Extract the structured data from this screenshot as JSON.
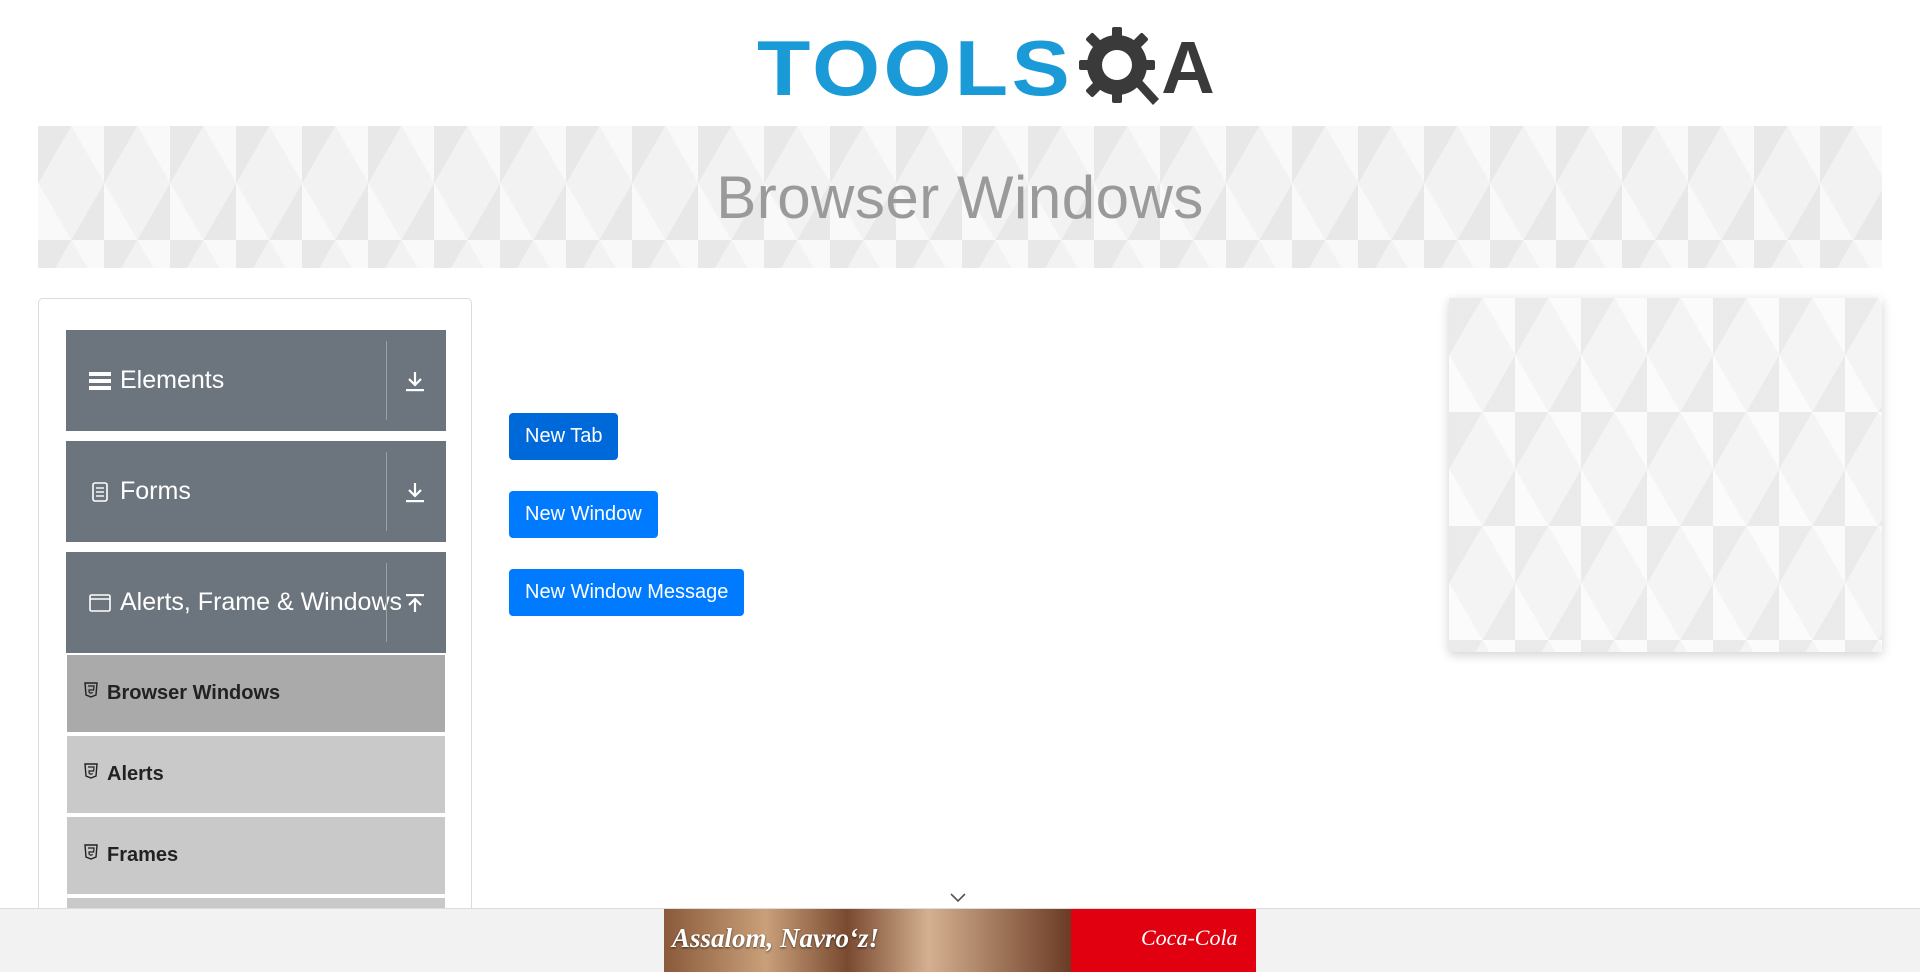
{
  "header": {
    "logo_text_left": "TOOLS",
    "logo_text_right": "A"
  },
  "banner": {
    "title": "Browser Windows"
  },
  "sidebar": {
    "groups": [
      {
        "label": "Elements",
        "icon": "hamburger-icon",
        "arrow": "download-arrow-icon"
      },
      {
        "label": "Forms",
        "icon": "document-icon",
        "arrow": "download-arrow-icon"
      },
      {
        "label": "Alerts, Frame & Windows",
        "icon": "window-icon",
        "arrow": "upload-arrow-icon"
      }
    ],
    "items": [
      {
        "label": "Browser Windows",
        "icon": "html5-icon",
        "active": true
      },
      {
        "label": "Alerts",
        "icon": "html5-icon",
        "active": false
      },
      {
        "label": "Frames",
        "icon": "html5-icon",
        "active": false
      }
    ]
  },
  "main": {
    "buttons": {
      "new_tab": "New Tab",
      "new_window": "New Window",
      "new_window_message": "New Window Message"
    }
  },
  "ad": {
    "text": "Assalom, Navro‘z!",
    "brand": "Coca-Cola"
  },
  "colors": {
    "primary": "#007bff",
    "primary_focused": "#0069d9",
    "group_bg": "#6c757d",
    "item_bg": "#c9c9c9",
    "item_active_bg": "#aaaaaa",
    "logo_blue": "#1a9bd7",
    "logo_dark": "#3a3a3a"
  }
}
